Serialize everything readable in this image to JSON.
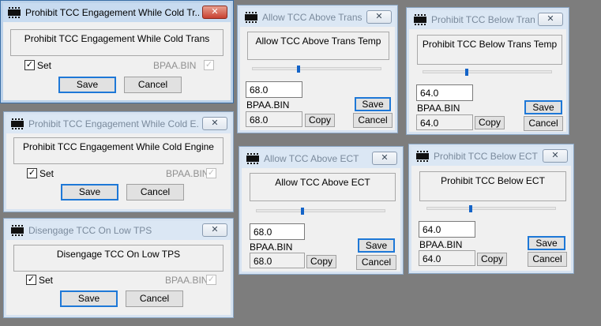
{
  "windows": {
    "w1": {
      "title": "Prohibit TCC Engagement While Cold Tr...",
      "close": "✕",
      "description": "Prohibit TCC Engagement While Cold Trans",
      "set_label": "Set",
      "check": "✓",
      "file": "BPAA.BIN",
      "save": "Save",
      "cancel": "Cancel"
    },
    "w2": {
      "title": "Prohibit TCC Engagement While Cold E...",
      "close": "✕",
      "description": "Prohibit TCC Engagement While Cold Engine",
      "set_label": "Set",
      "check": "✓",
      "file": "BPAA.BIN",
      "save": "Save",
      "cancel": "Cancel"
    },
    "w3": {
      "title": "Disengage TCC On Low TPS",
      "close": "✕",
      "description": "Disengage TCC On Low TPS",
      "set_label": "Set",
      "check": "✓",
      "file": "BPAA.BIN",
      "save": "Save",
      "cancel": "Cancel"
    },
    "w4": {
      "title": "Allow TCC Above Trans ...",
      "close": "✕",
      "description": "Allow TCC Above Trans Temp",
      "value": "68.0",
      "file": "BPAA.BIN",
      "file_value": "68.0",
      "save": "Save",
      "copy": "Copy",
      "cancel": "Cancel",
      "slider_fraction": 0.36
    },
    "w5": {
      "title": "Allow TCC Above ECT",
      "close": "✕",
      "description": "Allow TCC Above ECT",
      "value": "68.0",
      "file": "BPAA.BIN",
      "file_value": "68.0",
      "save": "Save",
      "copy": "Copy",
      "cancel": "Cancel",
      "slider_fraction": 0.36
    },
    "w6": {
      "title": "Prohibit TCC Below Tran...",
      "close": "✕",
      "description": "Prohibit TCC Below Trans Temp",
      "value": "64.0",
      "file": "BPAA.BIN",
      "file_value": "64.0",
      "save": "Save",
      "copy": "Copy",
      "cancel": "Cancel",
      "slider_fraction": 0.34
    },
    "w7": {
      "title": "Prohibit TCC Below ECT",
      "close": "✕",
      "description": "Prohibit TCC Below ECT",
      "value": "64.0",
      "file": "BPAA.BIN",
      "file_value": "64.0",
      "save": "Save",
      "copy": "Copy",
      "cancel": "Cancel",
      "slider_fraction": 0.34
    }
  },
  "colors": {
    "desktop": "#7d7d7d",
    "accent_border": "#1e78d7",
    "slider_thumb": "#1464c8",
    "close_active": "#c84030"
  }
}
